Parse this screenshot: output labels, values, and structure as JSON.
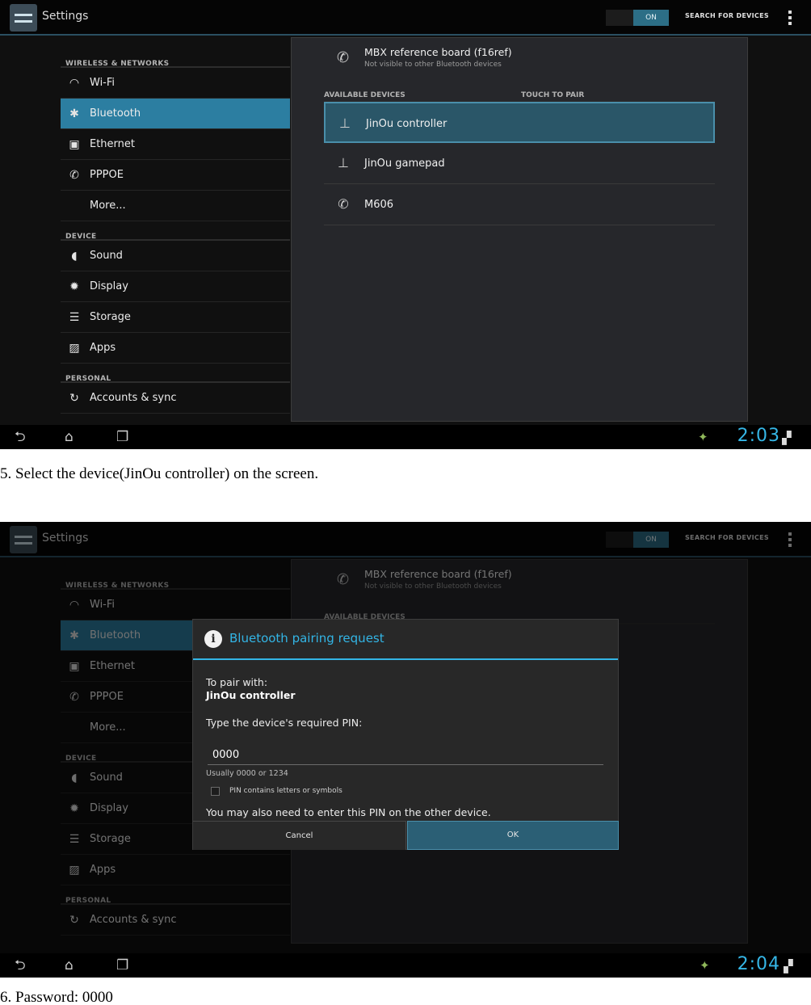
{
  "app": {
    "title": "Settings"
  },
  "header": {
    "toggle_label": "ON",
    "search_label": "SEARCH FOR DEVICES"
  },
  "sidebar": {
    "categories": {
      "wireless": "WIRELESS & NETWORKS",
      "device": "DEVICE",
      "personal": "PERSONAL"
    },
    "items": {
      "wifi": "Wi-Fi",
      "bluetooth": "Bluetooth",
      "ethernet": "Ethernet",
      "pppoe": "PPPOE",
      "more": "More...",
      "sound": "Sound",
      "display": "Display",
      "storage": "Storage",
      "apps": "Apps",
      "accounts": "Accounts & sync"
    }
  },
  "bluetooth": {
    "local_name": "MBX reference board (f16ref)",
    "local_status": "Not visible to other Bluetooth devices",
    "available_header": "AVAILABLE DEVICES",
    "touch_header": "TOUCH TO PAIR",
    "devices": [
      "JinOu controller",
      "JinOu gamepad",
      "M606"
    ]
  },
  "status": {
    "time_1": "2:03",
    "time_2": "2:04"
  },
  "dialog": {
    "title": "Bluetooth pairing request",
    "pair_with_label": "To pair with:",
    "device_name": "JinOu controller",
    "pin_prompt": "Type the device's required PIN:",
    "pin_value": "0000",
    "hint": "Usually 0000 or 1234",
    "checkbox_label": "PIN contains letters or symbols",
    "note": "You may also need to enter this PIN on the other device.",
    "cancel": "Cancel",
    "ok": "OK"
  },
  "captions": {
    "step5": "5. Select the device(JinOu controller) on the screen.",
    "step6": "6. Password: 0000"
  },
  "colors": {
    "accent": "#33b5e5",
    "selected": "#2c7ea1",
    "toggle_on": "#2c6e86"
  }
}
